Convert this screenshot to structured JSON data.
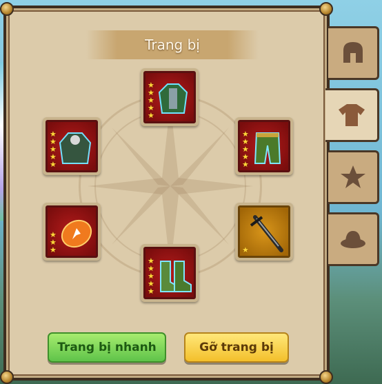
{
  "panel": {
    "title": "Trang bị"
  },
  "slots": [
    {
      "name": "top",
      "stars": 5,
      "frame": "red",
      "item": "armor"
    },
    {
      "name": "left-upper",
      "stars": 5,
      "frame": "red",
      "item": "armor"
    },
    {
      "name": "right-upper",
      "stars": 5,
      "frame": "red",
      "item": "pants"
    },
    {
      "name": "left-lower",
      "stars": 3,
      "frame": "red",
      "item": "ball"
    },
    {
      "name": "right-lower",
      "stars": 1,
      "frame": "gold",
      "item": "sword"
    },
    {
      "name": "bottom",
      "stars": 5,
      "frame": "red",
      "item": "boots"
    }
  ],
  "buttons": {
    "quick_equip": "Trang bị nhanh",
    "unequip": "Gỡ trang bị"
  },
  "tabs": [
    {
      "icon": "helmet-icon",
      "active": false
    },
    {
      "icon": "shirt-icon",
      "active": true
    },
    {
      "icon": "star-icon",
      "active": false
    },
    {
      "icon": "hat-icon",
      "active": false
    }
  ],
  "colors": {
    "panel_bg": "#dccbaa",
    "slot_red": "#b41b1b",
    "slot_gold": "#d8951a",
    "btn_green": "#5fc34a",
    "btn_yellow": "#f3c02b"
  }
}
